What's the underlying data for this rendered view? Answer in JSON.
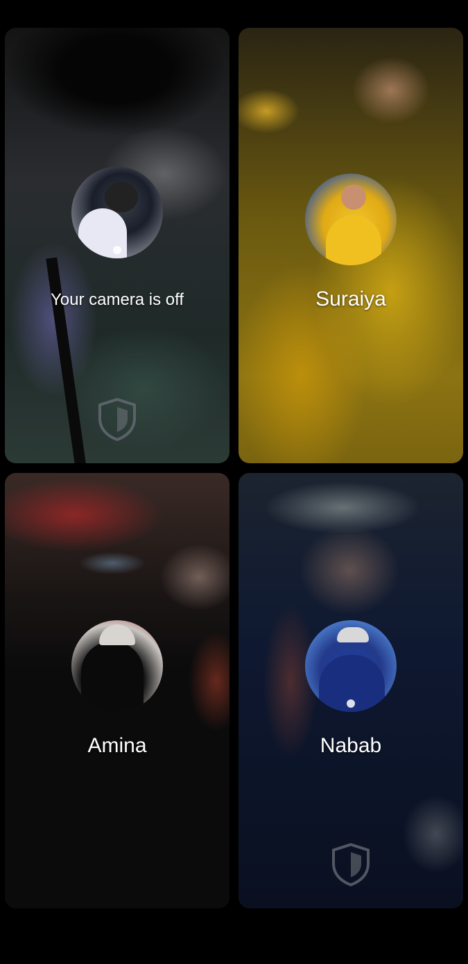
{
  "participants": [
    {
      "name": "Your camera is off",
      "avatar_icon": "profile-photo",
      "shield_icon": "shield-icon"
    },
    {
      "name": "Suraiya",
      "avatar_icon": "profile-photo"
    },
    {
      "name": "Amina",
      "avatar_icon": "profile-photo"
    },
    {
      "name": "Nabab",
      "avatar_icon": "profile-photo",
      "shield_icon": "shield-icon"
    }
  ],
  "colors": {
    "background": "#000000",
    "label_text": "#ffffff",
    "shield_stroke": "#6b6f78"
  }
}
